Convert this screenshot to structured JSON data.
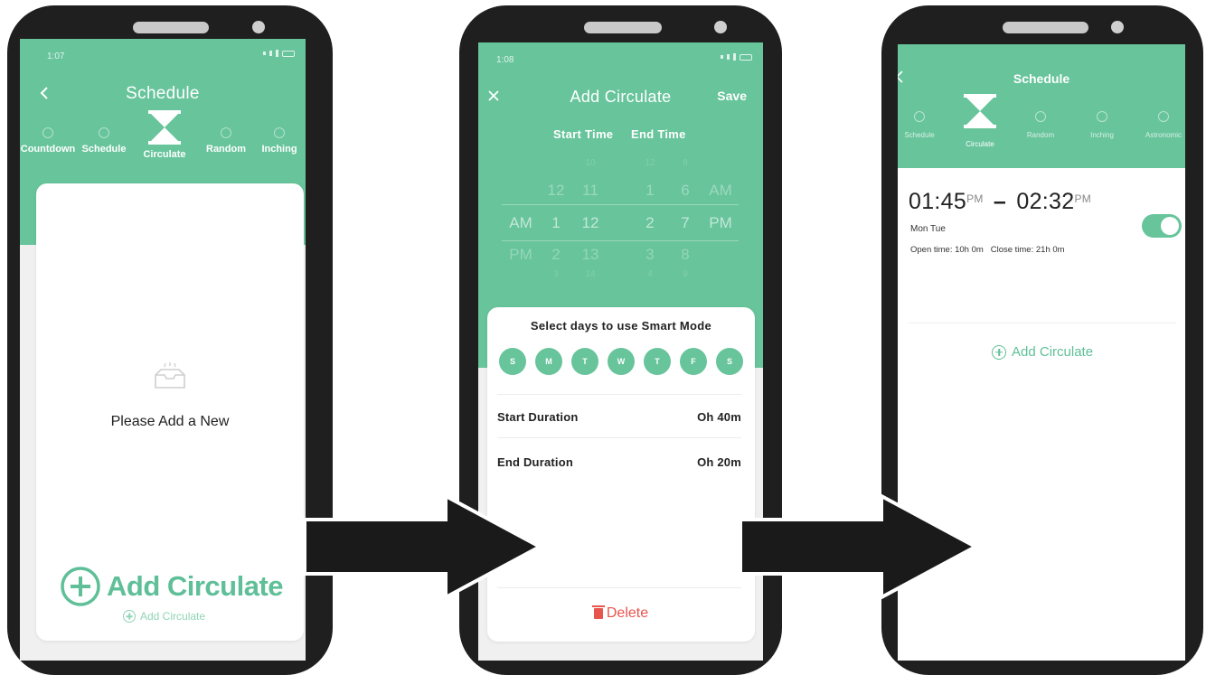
{
  "screen1": {
    "status_time": "1:07",
    "title": "Schedule",
    "modes": [
      {
        "label": "Countdown",
        "icon": "clock-icon"
      },
      {
        "label": "Schedule",
        "icon": "alarm-icon"
      },
      {
        "label": "Circulate",
        "icon": "hourglass-icon"
      },
      {
        "label": "Random",
        "icon": "timer-icon"
      },
      {
        "label": "Inching",
        "icon": "dial-icon"
      }
    ],
    "empty_text": "Please Add a New",
    "big_add_label": "Add Circulate",
    "small_add_label": "Add Circulate"
  },
  "screen2": {
    "status_time": "1:08",
    "title": "Add Circulate",
    "save_label": "Save",
    "start_time_label": "Start Time",
    "end_time_label": "End Time",
    "picker": {
      "faint_top": [
        "10",
        "12",
        "8"
      ],
      "upper": [
        "12",
        "11",
        "1",
        "6",
        "AM"
      ],
      "selected": [
        "AM",
        "1",
        "12",
        "2",
        "7",
        "PM"
      ],
      "lower": [
        "PM",
        "2",
        "13",
        "3",
        "8"
      ],
      "faint_bottom": [
        "3",
        "14",
        "4",
        "9"
      ]
    },
    "days_title": "Select days to use Smart Mode",
    "days": [
      "S",
      "M",
      "T",
      "W",
      "T",
      "F",
      "S"
    ],
    "start_duration_label": "Start Duration",
    "start_duration_value": "Oh 40m",
    "end_duration_label": "End Duration",
    "end_duration_value": "Oh 20m",
    "delete_label": "Delete"
  },
  "screen3": {
    "title": "Schedule",
    "tabs": [
      {
        "label": "Schedule",
        "icon": "alarm-icon"
      },
      {
        "label": "Circulate",
        "icon": "hourglass-icon"
      },
      {
        "label": "Random",
        "icon": "timer-icon"
      },
      {
        "label": "Inching",
        "icon": "dial-icon"
      },
      {
        "label": "Astronomic",
        "icon": "sun-icon"
      }
    ],
    "start_time": "01:45",
    "start_ampm": "PM",
    "dash": "–",
    "end_time": "02:32",
    "end_ampm": "PM",
    "days": "Mon Tue",
    "open_time": "Open time: 10h 0m",
    "close_time": "Close time: 21h 0m",
    "toggle_on": true,
    "add_label": "Add Circulate"
  },
  "colors": {
    "brand_green": "#67c49b",
    "delete_red": "#e8554d",
    "frame": "#1f1f1f"
  }
}
